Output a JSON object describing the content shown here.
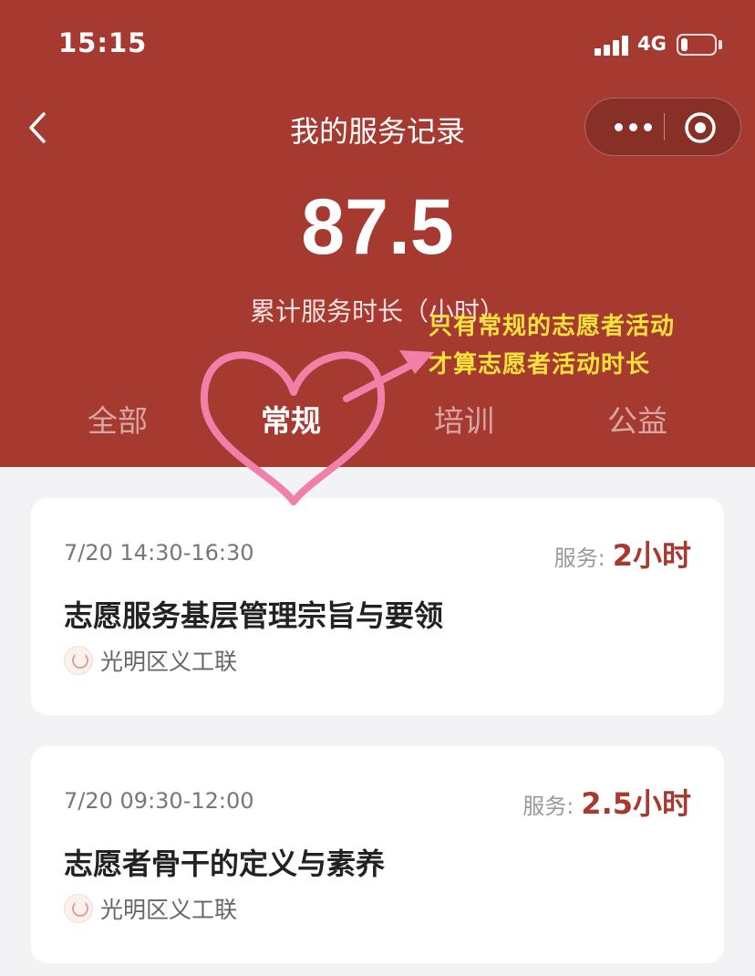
{
  "status_bar": {
    "time": "15:15",
    "network": "4G",
    "battery_level": 0.2
  },
  "nav": {
    "title": "我的服务记录",
    "back_icon": "chevron-left-icon",
    "more_icon": "more-dots-icon",
    "close_icon": "target-close-icon"
  },
  "summary": {
    "total_hours": "87.5",
    "label": "累计服务时长（小时）"
  },
  "tabs": [
    {
      "label": "全部",
      "active": false
    },
    {
      "label": "常规",
      "active": true
    },
    {
      "label": "培训",
      "active": false
    },
    {
      "label": "公益",
      "active": false
    }
  ],
  "annotation": {
    "line1": "只有常规的志愿者活动",
    "line2": "才算志愿者活动时长"
  },
  "records": [
    {
      "time": "7/20 14:30-16:30",
      "duration_label": "服务:",
      "duration": "2小时",
      "title": "志愿服务基层管理宗旨与要领",
      "organizer": "光明区义工联"
    },
    {
      "time": "7/20 09:30-12:00",
      "duration_label": "服务:",
      "duration": "2.5小时",
      "title": "志愿者骨干的定义与素养",
      "organizer": "光明区义工联"
    }
  ],
  "colors": {
    "header_bg": "#a63a31",
    "accent": "#a63a31",
    "annotation": "#f6e23b",
    "heart": "#f080a8"
  }
}
